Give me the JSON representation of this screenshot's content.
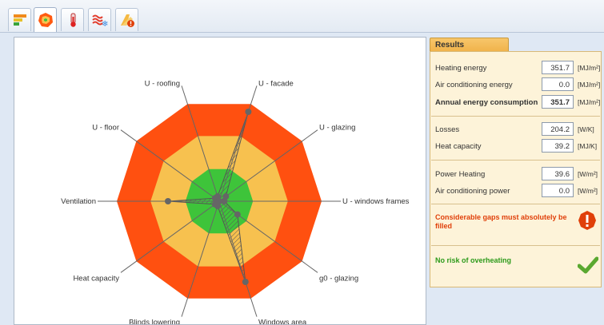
{
  "toolbar": {
    "tabs": [
      {
        "icon": "bars-chart-icon",
        "active": false
      },
      {
        "icon": "radar-chart-icon",
        "active": true
      },
      {
        "icon": "thermometer-icon",
        "active": false
      },
      {
        "icon": "heat-cold-icon",
        "active": false
      },
      {
        "icon": "warning-folder-icon",
        "active": false
      }
    ]
  },
  "radar": {
    "axes": [
      {
        "label": "U - facade",
        "value": 0.92
      },
      {
        "label": "U - glazing",
        "value": 0.08
      },
      {
        "label": "U - windows frames",
        "value": 0.05
      },
      {
        "label": "g0 - glazing",
        "value": 0.22
      },
      {
        "label": "Windows area",
        "value": 0.83
      },
      {
        "label": "Blinds lowering",
        "value": 0.05
      },
      {
        "label": "Heat capacity",
        "value": 0.05
      },
      {
        "label": "Ventilation",
        "value": 0.5
      },
      {
        "label": "U - floor",
        "value": 0.05
      },
      {
        "label": "U - roofing",
        "value": 0.05
      }
    ],
    "zones": {
      "good": "#3ec43a",
      "medium": "#f7c14f",
      "bad": "#ff5010"
    },
    "zone_limits": [
      0.33,
      0.67,
      1.0
    ]
  },
  "results": {
    "tab_label": "Results",
    "rows": [
      {
        "label": "Heating energy",
        "value": "351.7",
        "unit": "[MJ/m²]"
      },
      {
        "label": "Air conditioning energy",
        "value": "0.0",
        "unit": "[MJ/m²]"
      },
      {
        "label": "Annual energy consumption",
        "value": "351.7",
        "unit": "[MJ/m²]"
      },
      {
        "label": "Losses",
        "value": "204.2",
        "unit": "[W/K]"
      },
      {
        "label": "Heat capacity",
        "value": "39.2",
        "unit": "[MJ/K]"
      },
      {
        "label": "Power Heating",
        "value": "39.6",
        "unit": "[W/m²]"
      },
      {
        "label": "Air conditioning power",
        "value": "0.0",
        "unit": "[W/m²]"
      }
    ],
    "warning": "Considerable gaps must absolutely be filled",
    "ok": "No risk of overheating"
  }
}
